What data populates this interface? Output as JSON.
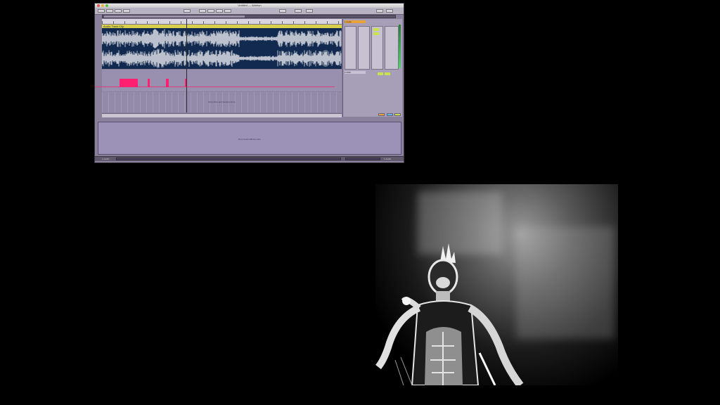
{
  "daw": {
    "window_title": "Untitled — Ableton",
    "clip_name": "Audio Track Clip",
    "track_name": "1 Audio",
    "midi_track_name": "2 MIDI",
    "drop_hint": "Drop Files and Devices Here",
    "lower_hint": "Drop Audio Effects Here",
    "status_text": "1-Audio",
    "status_track": "1-Audio",
    "colors": {
      "audio_clip_bg": "#122a4f",
      "waveform": "#e8e8ee",
      "midi_note": "#ff1f70",
      "clip_header": "#d8d04a",
      "daw_bg": "#8a829c"
    }
  },
  "video": {
    "description_icon": "live-performer-video-feed"
  }
}
